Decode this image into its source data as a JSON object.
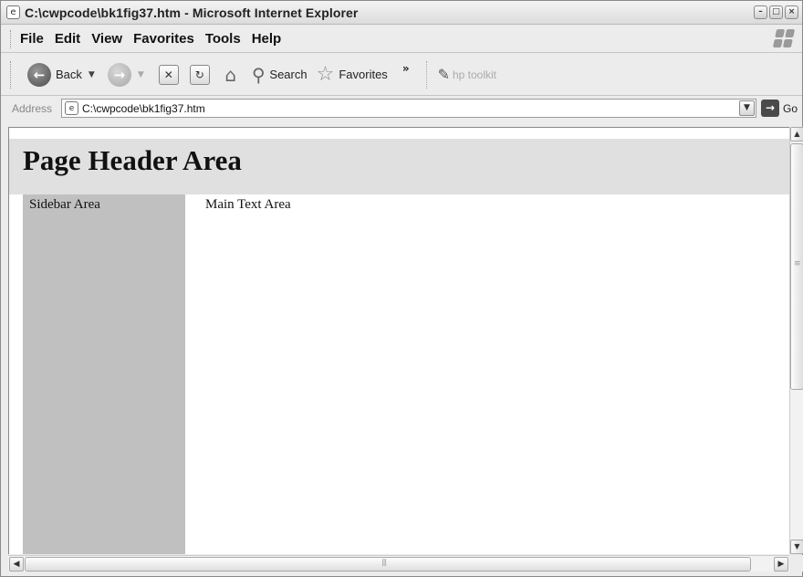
{
  "window": {
    "title": "C:\\cwpcode\\bk1fig37.htm - Microsoft Internet Explorer",
    "controls": {
      "minimize": "–",
      "maximize": "□",
      "close": "×"
    }
  },
  "menu": [
    "File",
    "Edit",
    "View",
    "Favorites",
    "Tools",
    "Help"
  ],
  "toolbar": {
    "back_label": "Back",
    "search_label": "Search",
    "favorites_label": "Favorites",
    "more_chevron": "»",
    "hp_label": "hp toolkit"
  },
  "address": {
    "label": "Address",
    "value": "C:\\cwpcode\\bk1fig37.htm",
    "go_label": "Go"
  },
  "page": {
    "header": "Page Header Area",
    "sidebar": "Sidebar Area",
    "main": "Main Text Area"
  },
  "icons": {
    "ie_page": "ie-page-icon",
    "back": "back-arrow-icon",
    "forward": "forward-arrow-icon",
    "stop": "stop-icon",
    "refresh": "refresh-icon",
    "home": "home-icon",
    "search": "search-magnifier-icon",
    "favorites": "star-icon",
    "hp": "hp-toolkit-icon",
    "go": "go-arrow-icon",
    "windows_logo": "windows-flag-icon"
  },
  "colors": {
    "header_bg": "#e0e0e0",
    "sidebar_bg": "#c0c0c0",
    "chrome_bg": "#ececec"
  }
}
